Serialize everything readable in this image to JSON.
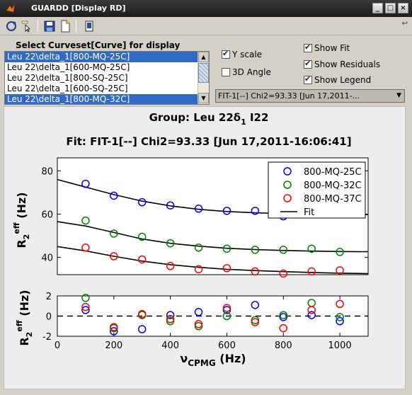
{
  "window": {
    "title": "GUARDD [Display RD]",
    "buttons": {
      "minimize": "_",
      "maximize": "□",
      "close": "×"
    }
  },
  "toolbar": {
    "icons": [
      "rotate-icon",
      "data-cursor-icon",
      "save-icon",
      "new-figure-icon",
      "print-icon"
    ],
    "overflow_arrow": "↩"
  },
  "curveset_panel": {
    "label": "Select Curveset[Curve] for display",
    "items": [
      {
        "label": "Leu 22\\delta_1[800-MQ-25C]",
        "selected": true
      },
      {
        "label": "Leu 22\\delta_1[600-MQ-25C]",
        "selected": false
      },
      {
        "label": "Leu 22\\delta_1[800-SQ-25C]",
        "selected": false
      },
      {
        "label": "Leu 22\\delta_1[600-SQ-25C]",
        "selected": false
      },
      {
        "label": "Leu 22\\delta_1[800-MQ-32C]",
        "selected": true
      }
    ]
  },
  "options": {
    "y_scale": {
      "label": "Y scale",
      "checked": true
    },
    "angle_3d": {
      "label": "3D Angle",
      "checked": false
    },
    "show_fit": {
      "label": "Show Fit",
      "checked": true
    },
    "show_residuals": {
      "label": "Show Residuals",
      "checked": true
    },
    "show_legend": {
      "label": "Show Legend",
      "checked": true
    }
  },
  "fit_dropdown": {
    "selected": "FIT-1[--] Chi2=93.33 [Jun 17,2011-..."
  },
  "figure": {
    "group_title_prefix": "Group: Leu 22δ",
    "group_title_sub": "1",
    "group_title_suffix": " I22",
    "fit_title": "Fit: FIT-1[--] Chi2=93.33 [Jun 17,2011-16:06:41]",
    "colors": {
      "series1": "#0000ff",
      "series2": "#008000",
      "series3": "#ff0000",
      "fit": "#000000"
    }
  },
  "chart_data": [
    {
      "type": "scatter",
      "title": "Fit: FIT-1[--] Chi2=93.33 [Jun 17,2011-16:06:41]",
      "ylabel": "R2eff (Hz)",
      "xlabel": "",
      "xlim": [
        0,
        1100
      ],
      "ylim": [
        32,
        86
      ],
      "yticks": [
        40,
        60,
        80
      ],
      "x": [
        100,
        200,
        300,
        400,
        500,
        600,
        700,
        800,
        900,
        1000
      ],
      "series": [
        {
          "name": "800-MQ-25C",
          "color": "#0000ff",
          "values": [
            74,
            68.5,
            65.5,
            64,
            62.5,
            61.5,
            61.5,
            59,
            60,
            60
          ]
        },
        {
          "name": "800-MQ-32C",
          "color": "#008000",
          "values": [
            57,
            51,
            49.5,
            46.5,
            44.5,
            44,
            43.5,
            43.5,
            44,
            42.5
          ]
        },
        {
          "name": "800-MQ-37C",
          "color": "#ff0000",
          "values": [
            44.5,
            40.5,
            39,
            36,
            34.5,
            35,
            33.5,
            32.5,
            33.5,
            34
          ]
        }
      ],
      "fit": {
        "name": "Fit",
        "x": [
          0,
          100,
          200,
          300,
          400,
          500,
          600,
          700,
          800,
          900,
          1000,
          1100
        ],
        "curves": [
          [
            76,
            72.5,
            69,
            66,
            63.8,
            62.2,
            61.2,
            60.6,
            60.2,
            60,
            59.9,
            59.8
          ],
          [
            56.5,
            54.5,
            51.5,
            48.5,
            46.5,
            45.2,
            44.2,
            43.6,
            43.2,
            42.9,
            42.7,
            42.6
          ],
          [
            45,
            43,
            40.5,
            38.3,
            36.6,
            35.4,
            34.5,
            33.9,
            33.4,
            33,
            32.7,
            32.5
          ]
        ]
      },
      "legend": "top-right",
      "grid": false
    },
    {
      "type": "scatter",
      "title": "",
      "ylabel": "R2eff (Hz)",
      "xlabel": "νCPMG (Hz)",
      "xlim": [
        0,
        1100
      ],
      "ylim": [
        -2,
        2
      ],
      "yticks": [
        -2,
        0,
        2
      ],
      "xticks": [
        0,
        200,
        400,
        600,
        800,
        1000
      ],
      "x": [
        100,
        200,
        300,
        400,
        500,
        600,
        700,
        800,
        900,
        1000
      ],
      "series": [
        {
          "name": "800-MQ-25C",
          "color": "#0000ff",
          "values": [
            0.6,
            -1.5,
            -1.3,
            0.1,
            0.4,
            0.6,
            1.1,
            -0.1,
            0.1,
            -0.5
          ]
        },
        {
          "name": "800-MQ-32C",
          "color": "#008000",
          "values": [
            1.8,
            -1.2,
            0.1,
            -0.5,
            -1.0,
            0.0,
            -0.4,
            0.1,
            1.3,
            -0.1
          ]
        },
        {
          "name": "800-MQ-37C",
          "color": "#ff0000",
          "values": [
            0.9,
            -1.1,
            0.2,
            -0.3,
            -0.8,
            0.8,
            -0.6,
            -1.2,
            0.6,
            1.2
          ]
        }
      ],
      "zero_line": true,
      "grid": false
    }
  ]
}
